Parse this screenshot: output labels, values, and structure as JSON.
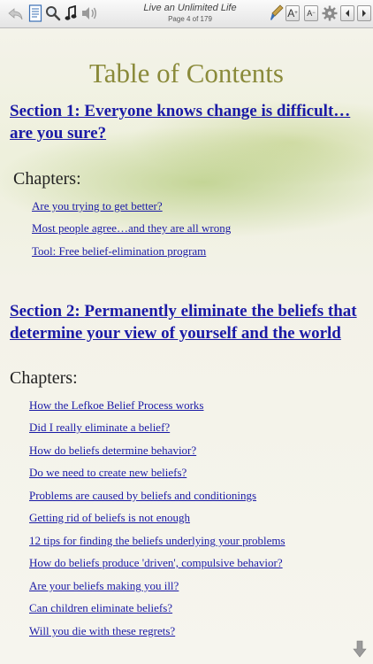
{
  "toolbar": {
    "title": "Live an Unlimited Life",
    "page": "Page 4 of 179",
    "font_larger": "A",
    "font_smaller": "A"
  },
  "toc": {
    "title": "Table of Contents",
    "section1": {
      "title": "Section 1: Everyone knows change is difficult…are you sure?",
      "chapters_label": "Chapters:",
      "chapters": [
        "Are you trying to get better?",
        "Most people agree…and they are all wrong",
        "Tool: Free belief-elimination program"
      ]
    },
    "section2": {
      "title": "Section 2:  Permanently eliminate the beliefs that determine your view of yourself and the world",
      "chapters_label": "Chapters:",
      "chapters": [
        "How the Lefkoe Belief Process works",
        "Did I really eliminate a belief?",
        "How do beliefs determine behavior?",
        "Do we need to create new beliefs?",
        "Problems are caused by beliefs and conditionings",
        "Getting rid of beliefs is not enough",
        "12 tips for finding the beliefs underlying your problems",
        "How do beliefs produce 'driven', compulsive behavior?",
        "Are your beliefs making you ill?",
        "Can children eliminate beliefs?",
        "Will you die with these regrets?"
      ]
    }
  },
  "colors": {
    "link": "#1a1aa6",
    "title": "#8a8a3a"
  }
}
